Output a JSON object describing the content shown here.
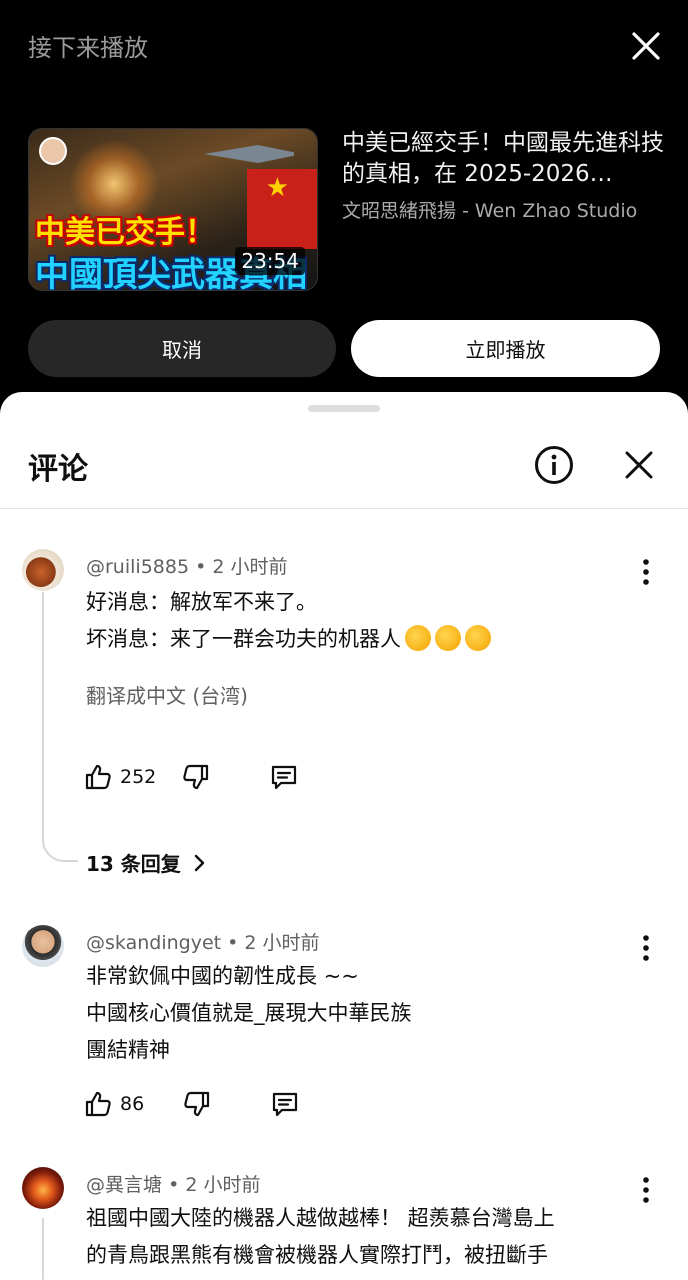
{
  "up_next": {
    "label": "接下来播放",
    "video": {
      "thumbnail_text_line1": "中美已交手！",
      "thumbnail_text_line2": "中國頂尖武器真相",
      "duration": "23:54",
      "title": "中美已經交手！中國最先進科技的真相，在 2025-2026…",
      "channel": "文昭思緒飛揚 - Wen Zhao Studio"
    },
    "cancel_label": "取消",
    "play_now_label": "立即播放"
  },
  "comments_panel": {
    "title": "评论",
    "comments": [
      {
        "handle": "@ruili5885",
        "time": "2 小时前",
        "line1": "好消息：解放军不来了。",
        "line2": "坏消息：来了一群会功夫的机器人",
        "translate_label": "翻译成中文 (台湾)",
        "likes": "252",
        "replies_label": "13 条回复"
      },
      {
        "handle": "@skandingyet",
        "time": "2 小时前",
        "line1": "非常欽佩中國的韌性成長 ~~",
        "line2": "中國核心價值就是_展現大中華民族",
        "line3": "團結精神",
        "likes": "86"
      },
      {
        "handle": "@異言塘",
        "time": "2 小时前",
        "line1": "祖國中國大陸的機器人越做越棒！ 超羨慕台灣島上",
        "line2": "的青鳥跟黑熊有機會被機器人實際打鬥，被扭斷手"
      }
    ]
  }
}
